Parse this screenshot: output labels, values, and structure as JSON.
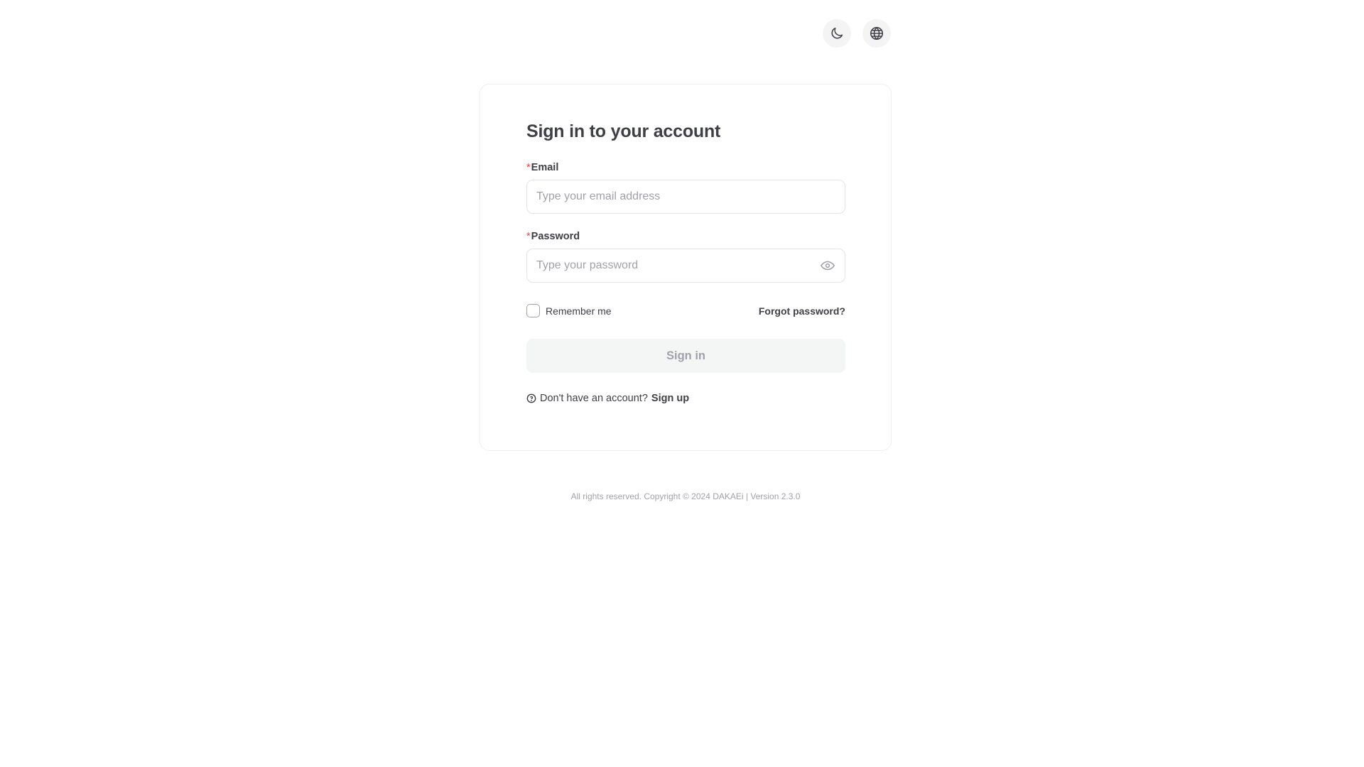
{
  "top_actions": {
    "theme_toggle": {
      "icon": "moon-icon",
      "label": "Toggle dark mode"
    },
    "language": {
      "icon": "globe-icon",
      "label": "Change language"
    }
  },
  "form": {
    "title": "Sign in to your account",
    "required_marker": "*",
    "email": {
      "label": "Email",
      "value": "",
      "placeholder": "Type your email address"
    },
    "password": {
      "label": "Password",
      "value": "",
      "placeholder": "Type your password",
      "toggle_icon": "eye-icon"
    },
    "remember_me": {
      "label": "Remember me",
      "checked": false
    },
    "forgot_password": "Forgot password?",
    "submit_label": "Sign in",
    "signup_prompt": "Don't have an account?",
    "signup_link": "Sign up"
  },
  "footer": {
    "text": "All rights reserved. Copyright © 2024 DAKAEi | Version 2.3.0"
  },
  "colors": {
    "required": "#ef4444",
    "text": "#3f3f46",
    "muted": "#a1a1aa",
    "disabled_button_bg": "#f4f5f5"
  }
}
